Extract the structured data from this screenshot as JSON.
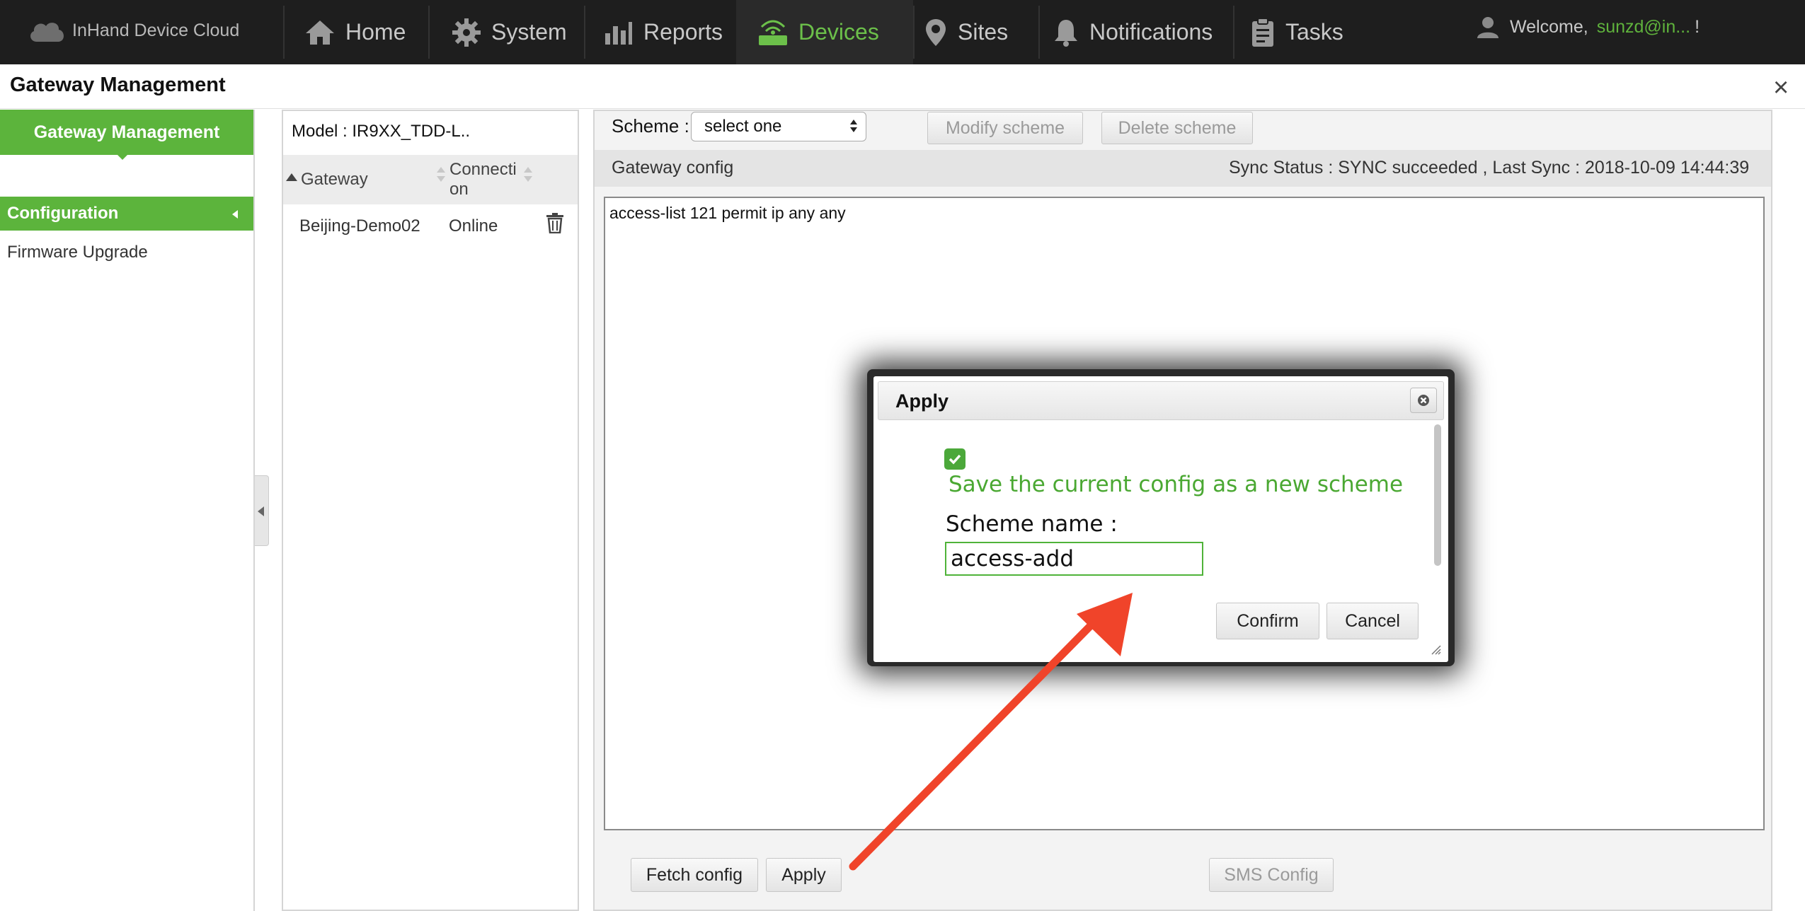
{
  "topnav": {
    "brand": "InHand Device Cloud",
    "items": [
      {
        "label": "Home",
        "icon": "home-icon"
      },
      {
        "label": "System",
        "icon": "gear-icon"
      },
      {
        "label": "Reports",
        "icon": "bar-chart-icon"
      },
      {
        "label": "Devices",
        "icon": "router-icon",
        "active": true
      },
      {
        "label": "Sites",
        "icon": "map-pin-icon"
      },
      {
        "label": "Notifications",
        "icon": "bell-icon"
      },
      {
        "label": "Tasks",
        "icon": "clipboard-icon"
      }
    ],
    "welcome": "Welcome,",
    "user": "sunzd@in...",
    "welcome_suffix": "!"
  },
  "header": {
    "title": "Gateway Management",
    "close": "×"
  },
  "sidebar": {
    "title": "Gateway Management",
    "items": [
      {
        "label": "Configuration",
        "active": true
      },
      {
        "label": "Firmware Upgrade"
      }
    ]
  },
  "gateways": {
    "model": "Model : IR9XX_TDD-L..",
    "columns": [
      "Gateway",
      "Connecti on"
    ],
    "rows": [
      {
        "name": "Beijing-Demo02",
        "connection": "Online"
      }
    ]
  },
  "config": {
    "scheme_label": "Scheme :",
    "scheme_value": "select one",
    "modify_scheme": "Modify scheme",
    "delete_scheme": "Delete scheme",
    "title": "Gateway config",
    "sync_status": "Sync Status : SYNC succeeded , Last Sync : 2018-10-09 14:44:39",
    "content": "access-list 121 permit ip any any",
    "fetch_config": "Fetch config",
    "apply": "Apply",
    "sms_config": "SMS Config"
  },
  "modal": {
    "title": "Apply",
    "save_as_new": "Save the current config as a new scheme",
    "save_checked": true,
    "scheme_name_label": "Scheme name :",
    "scheme_name_value": "access-add",
    "confirm": "Confirm",
    "cancel": "Cancel"
  },
  "colors": {
    "accent": "#5cb43c",
    "nav_bg": "#1e1e1e",
    "annotation_arrow": "#f0442a"
  }
}
